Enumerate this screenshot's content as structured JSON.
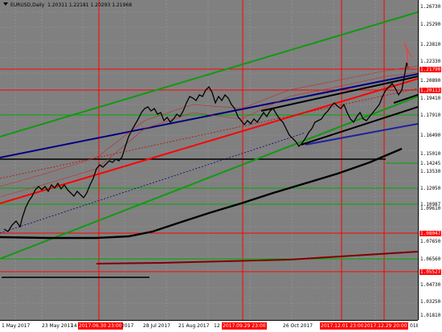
{
  "header": {
    "symbol": "EURUSD,Daily",
    "ohlc": "1.20311 1.22181 1.20293 1.21968"
  },
  "price_axis": {
    "labels": [
      "1.26730",
      "1.25290",
      "1.23810",
      "1.22330",
      "1.21790",
      "1.20890",
      "1.20113",
      "1.19410",
      "1.17910",
      "1.16490",
      "1.15010",
      "1.14245",
      "1.13530",
      "1.12050",
      "1.10987",
      "1.09610",
      "1.08047",
      "1.07650",
      "1.06560",
      "1.05527",
      "1.04730",
      "1.03250",
      "1.01810"
    ],
    "highlighted": [
      "1.21790",
      "1.20113",
      "1.08047",
      "1.05527"
    ]
  },
  "time_axis": {
    "labels": [
      "1 May 2017",
      "23 May 2017",
      "14 Jun 2017",
      "2017.06.30 23:00",
      "2017",
      "28 Jul 2017",
      "21 Aug 2017",
      "12",
      "2017.09.29 23:00",
      "26 Oct 2017",
      "2017.12.01 23:00",
      "2017.12.29 20:00",
      "018"
    ],
    "highlighted": [
      "2017.06.30 23:00",
      "2017.09.29 23:00",
      "2017.12.01 23:00",
      "2017.12.29 20:00"
    ]
  },
  "colors": {
    "background": "#808080",
    "grid": "#9a9a9a",
    "resistance": "#ff0000",
    "support": "#00a000",
    "channel_green": "#119911",
    "trend_blue": "#000080",
    "ma_black": "#000000",
    "ma_brown": "#800000",
    "candle": "#000000"
  }
}
